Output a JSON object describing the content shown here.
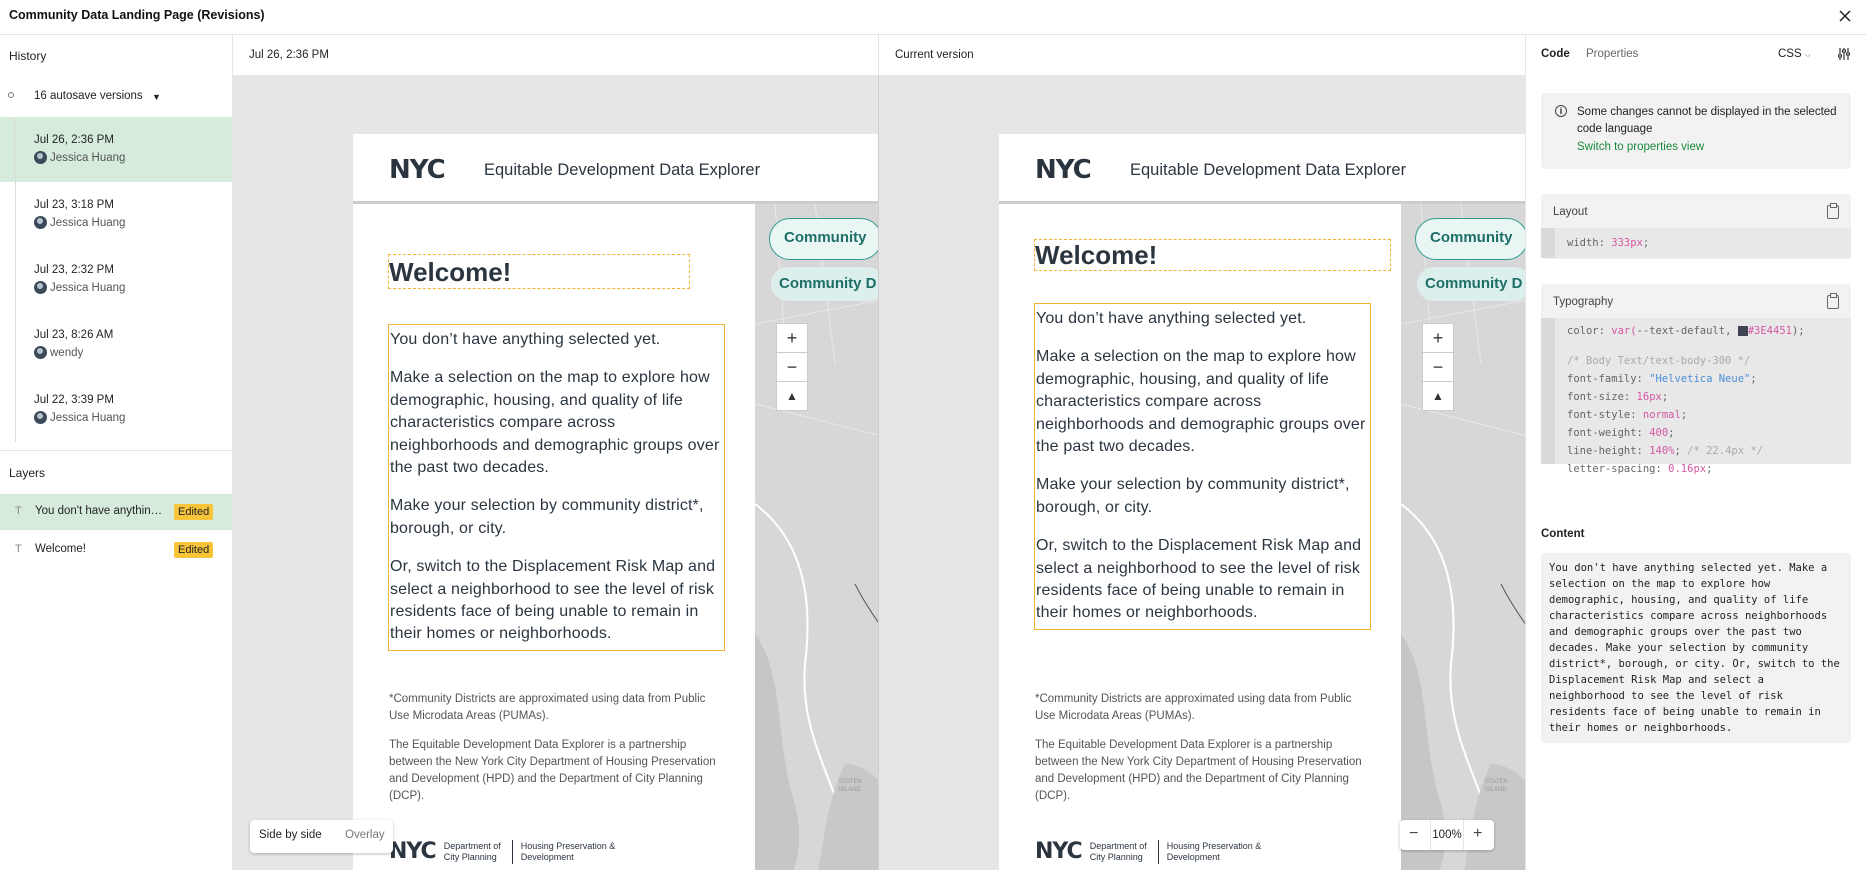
{
  "window": {
    "title": "Community Data Landing Page (Revisions)"
  },
  "history": {
    "title": "History",
    "autosave_label": "16 autosave versions",
    "versions": [
      {
        "time": "Jul 26, 2:36 PM",
        "user": "Jessica Huang"
      },
      {
        "time": "Jul 23, 3:18 PM",
        "user": "Jessica Huang"
      },
      {
        "time": "Jul 23, 2:32 PM",
        "user": "Jessica Huang"
      },
      {
        "time": "Jul 23, 8:26 AM",
        "user": "wendy"
      },
      {
        "time": "Jul 22, 3:39 PM",
        "user": "Jessica Huang"
      }
    ]
  },
  "layers": {
    "title": "Layers",
    "items": [
      {
        "label": "You don't have anything selected yet. Make a selection",
        "badge": "Edited"
      },
      {
        "label": "Welcome!",
        "badge": "Edited"
      }
    ]
  },
  "left_pane": {
    "header": "Jul 26, 2:36 PM"
  },
  "right_pane": {
    "header": "Current version"
  },
  "artboard": {
    "title": "Equitable Development Data Explorer",
    "logo": "NYC",
    "welcome": "Welcome!",
    "paragraphs": [
      "You don’t have anything selected yet.",
      "Make a selection on the map to explore how demographic, housing, and quality of life characteristics compare across neighborhoods and demographic groups over the past two decades.",
      "Make your selection by community district*, borough, or city.",
      "Or, switch to the Displacement Risk Map and select a neighborhood to see the level of risk residents face of being unable to remain in their homes or neighborhoods."
    ],
    "note1": "*Community Districts are approximated using data from Public Use Microdata Areas (PUMAs).",
    "note2": "The Equitable Development Data Explorer is a partnership between the New York City Department of Housing Preservation and Development (HPD) and the Department of City Planning (DCP).",
    "map_pill1": "Community",
    "map_pill2": "Community D",
    "footer_dcp": "Department of City Planning",
    "footer_hpd": "Housing Preservation & Development",
    "footer_logo": "NYC",
    "map_label": "STATEN ISLAND"
  },
  "view_toggle": {
    "side_by_side": "Side by side",
    "overlay": "Overlay"
  },
  "zoom": {
    "minus": "−",
    "value": "100%",
    "plus": "+"
  },
  "inspector": {
    "tab_code": "Code",
    "tab_properties": "Properties",
    "language": "CSS",
    "notice": "Some changes cannot be displayed in the selected code language",
    "notice_link": "Switch to properties view",
    "layout_title": "Layout",
    "layout_prop": "width:",
    "layout_val": "333px",
    "typography_title": "Typography",
    "color_prop": "color:",
    "color_fn": "var(",
    "color_var": "--text-default,",
    "color_hex": "#3E4451",
    "color_close": ");",
    "comment": "/* Body Text/text-body-300 */",
    "font_family_prop": "font-family:",
    "font_family_val": "\"Helvetica Neue\"",
    "font_size_prop": "font-size:",
    "font_size_val": "16px",
    "font_style_prop": "font-style:",
    "font_style_val": "normal",
    "font_weight_prop": "font-weight:",
    "font_weight_val": "400",
    "line_height_prop": "line-height:",
    "line_height_val": "140%",
    "line_height_comment": "/* 22.4px */",
    "letter_spacing_prop": "letter-spacing:",
    "letter_spacing_val": "0.16px",
    "content_title": "Content",
    "content_text": "You don't have anything selected yet. Make a selection on the map to explore how demographic, housing, and quality of life characteristics compare across neighborhoods and demographic groups over the past two decades. Make your selection by community district*, borough, or city. Or, switch to the Displacement Risk Map and select a neighborhood to see the level of risk residents face of being unable to remain in their homes or neighborhoods."
  },
  "colors": {
    "accent_green": "#d6ebdc",
    "badge": "#f7c43a",
    "link": "#1a8a3b",
    "selection": "#f2b233",
    "color_swatch": "#3E4451"
  }
}
